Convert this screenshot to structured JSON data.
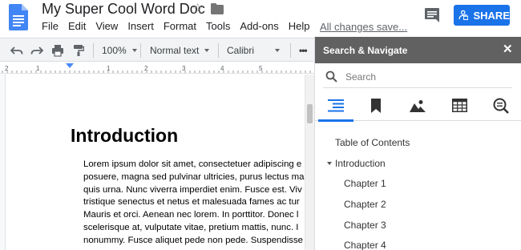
{
  "app": {
    "doc_title": "My Super Cool Word Doc",
    "save_status": "All changes save...",
    "share_label": "SHARE",
    "icons": [
      "docs-icon",
      "star-icon",
      "folder-icon",
      "comment-icon",
      "share-icon"
    ],
    "accent_color": "#1a73e8"
  },
  "menu": [
    "File",
    "Edit",
    "View",
    "Insert",
    "Format",
    "Tools",
    "Add-ons",
    "Help"
  ],
  "toolbar": {
    "zoom": "100%",
    "style": "Normal text",
    "font": "Calibri",
    "more": "•••",
    "icons": [
      "undo-icon",
      "redo-icon",
      "print-icon",
      "paint-format-icon"
    ]
  },
  "ruler": {
    "numbers": [
      "2",
      "1",
      "1",
      "2",
      "3",
      "4",
      "5"
    ]
  },
  "document": {
    "heading": "Introduction",
    "lines": [
      "Lorem ipsum dolor sit amet, consectetuer adipiscing e",
      "posuere, magna sed pulvinar ultricies, purus lectus ma",
      "quis urna. Nunc viverra imperdiet enim. Fusce est. Viv",
      "tristique senectus et netus et malesuada fames ac tur",
      "Mauris et orci. Aenean nec lorem. In porttitor. Donec l",
      "scelerisque at, vulputate vitae, pretium mattis, nunc. I",
      "nonummy. Fusce aliquet pede non pede. Suspendisse"
    ]
  },
  "panel": {
    "title": "Search & Navigate",
    "close": "✕",
    "search_placeholder": "Search",
    "tabs": [
      "toc-icon",
      "bookmark-icon",
      "image-icon",
      "table-icon",
      "find-icon"
    ],
    "toc_title": "Table of Contents",
    "toc_items": [
      "Introduction",
      "Chapter 1",
      "Chapter 2",
      "Chapter 3",
      "Chapter 4"
    ],
    "header_color": "#616161"
  }
}
